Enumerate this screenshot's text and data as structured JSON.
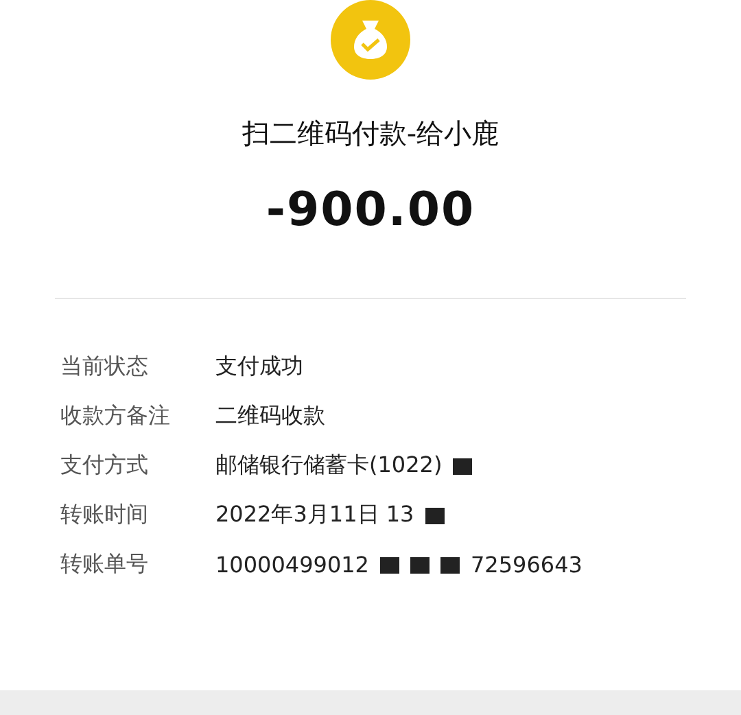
{
  "header": {
    "title": "扫二维码付款-给小鹿",
    "amount": "-900.00"
  },
  "details": [
    {
      "label": "当前状态",
      "value": [
        {
          "kind": "text",
          "text": "支付成功"
        }
      ]
    },
    {
      "label": "收款方备注",
      "value": [
        {
          "kind": "text",
          "text": "二维码收款"
        }
      ]
    },
    {
      "label": "支付方式",
      "value": [
        {
          "kind": "text",
          "text": "邮储银行储蓄卡(1022)"
        },
        {
          "kind": "redaction"
        }
      ]
    },
    {
      "label": "转账时间",
      "value": [
        {
          "kind": "text",
          "text": "2022年3月11日 13"
        },
        {
          "kind": "redaction"
        }
      ]
    },
    {
      "label": "转账单号",
      "value": [
        {
          "kind": "text",
          "text": "10000499012"
        },
        {
          "kind": "redaction"
        },
        {
          "kind": "redaction"
        },
        {
          "kind": "redaction"
        },
        {
          "kind": "text",
          "text": "72596643"
        }
      ]
    }
  ]
}
